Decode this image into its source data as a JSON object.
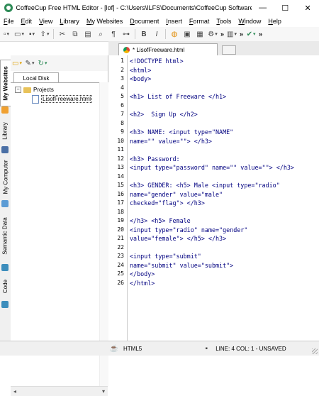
{
  "window": {
    "title": "CoffeeCup Free HTML Editor - [lof] - C:\\Users\\ILFS\\Documents\\CoffeeCup Software...",
    "minimize_glyph": "—",
    "maximize_glyph": "☐",
    "close_glyph": "✕"
  },
  "menu": {
    "items": [
      {
        "key": "F",
        "rest": "ile"
      },
      {
        "key": "E",
        "rest": "dit"
      },
      {
        "key": "V",
        "rest": "iew"
      },
      {
        "key": "L",
        "rest": "ibrary"
      },
      {
        "key": "M",
        "rest": "y Websites"
      },
      {
        "key": "D",
        "rest": "ocument"
      },
      {
        "key": "I",
        "rest": "nsert"
      },
      {
        "key": "F",
        "rest": "ormat"
      },
      {
        "key": "T",
        "rest": "ools"
      },
      {
        "key": "W",
        "rest": "indow"
      },
      {
        "key": "H",
        "rest": "elp"
      }
    ]
  },
  "toolbar": {
    "bold_label": "B",
    "italic_label": "I",
    "paragraph_label": "¶",
    "more_label": "»"
  },
  "sidebar": {
    "vertical_tabs": [
      "My Websites",
      "Library",
      "My Computer",
      "Semantic Data",
      "Code"
    ]
  },
  "panel": {
    "tab_label": "Local Disk",
    "tree": {
      "root": "Projects",
      "root_expander": "−",
      "file": "LisofFreeware.html"
    }
  },
  "editor": {
    "tab_label": "* LisofFreeware.html",
    "lines": [
      {
        "n": "1",
        "code": "<!DOCTYPE html>"
      },
      {
        "n": "2",
        "code": "<html>"
      },
      {
        "n": "3",
        "code": "<body>"
      },
      {
        "n": "4",
        "code": ""
      },
      {
        "n": "5",
        "code": "<h1> List of Freeware </h1>"
      },
      {
        "n": "6",
        "code": ""
      },
      {
        "n": "7",
        "code": "<h2>  Sign Up </h2>"
      },
      {
        "n": "8",
        "code": ""
      },
      {
        "n": "9",
        "code": "<h3> NAME: <input type=\"NAME\""
      },
      {
        "n": "10",
        "code": "name=\"\" value=\"\"> </h3>"
      },
      {
        "n": "11",
        "code": ""
      },
      {
        "n": "12",
        "code": "<h3> Password:"
      },
      {
        "n": "13",
        "code": "<input type=\"password\" name=\"\" value=\"\"> </h3>"
      },
      {
        "n": "14",
        "code": ""
      },
      {
        "n": "15",
        "code": "<h3> GENDER: <h5> Male <input type=\"radio\""
      },
      {
        "n": "16",
        "code": "name=\"gender\" value=\"male\""
      },
      {
        "n": "17",
        "code": "checked=\"flag\"> </h3>"
      },
      {
        "n": "18",
        "code": ""
      },
      {
        "n": "19",
        "code": "</h3> <h5> Female"
      },
      {
        "n": "20",
        "code": "<input type=\"radio\" name=\"gender\""
      },
      {
        "n": "21",
        "code": "value=\"female\"> </h5> </h3>"
      },
      {
        "n": "22",
        "code": ""
      },
      {
        "n": "23",
        "code": "<input type=\"submit\""
      },
      {
        "n": "24",
        "code": "name=\"submit\" value=\"submit\">"
      },
      {
        "n": "25",
        "code": "</body>"
      },
      {
        "n": "26",
        "code": "</html>"
      }
    ]
  },
  "status": {
    "mode": "HTML5",
    "position": "LINE: 4  COL: 1 - UNSAVED"
  }
}
